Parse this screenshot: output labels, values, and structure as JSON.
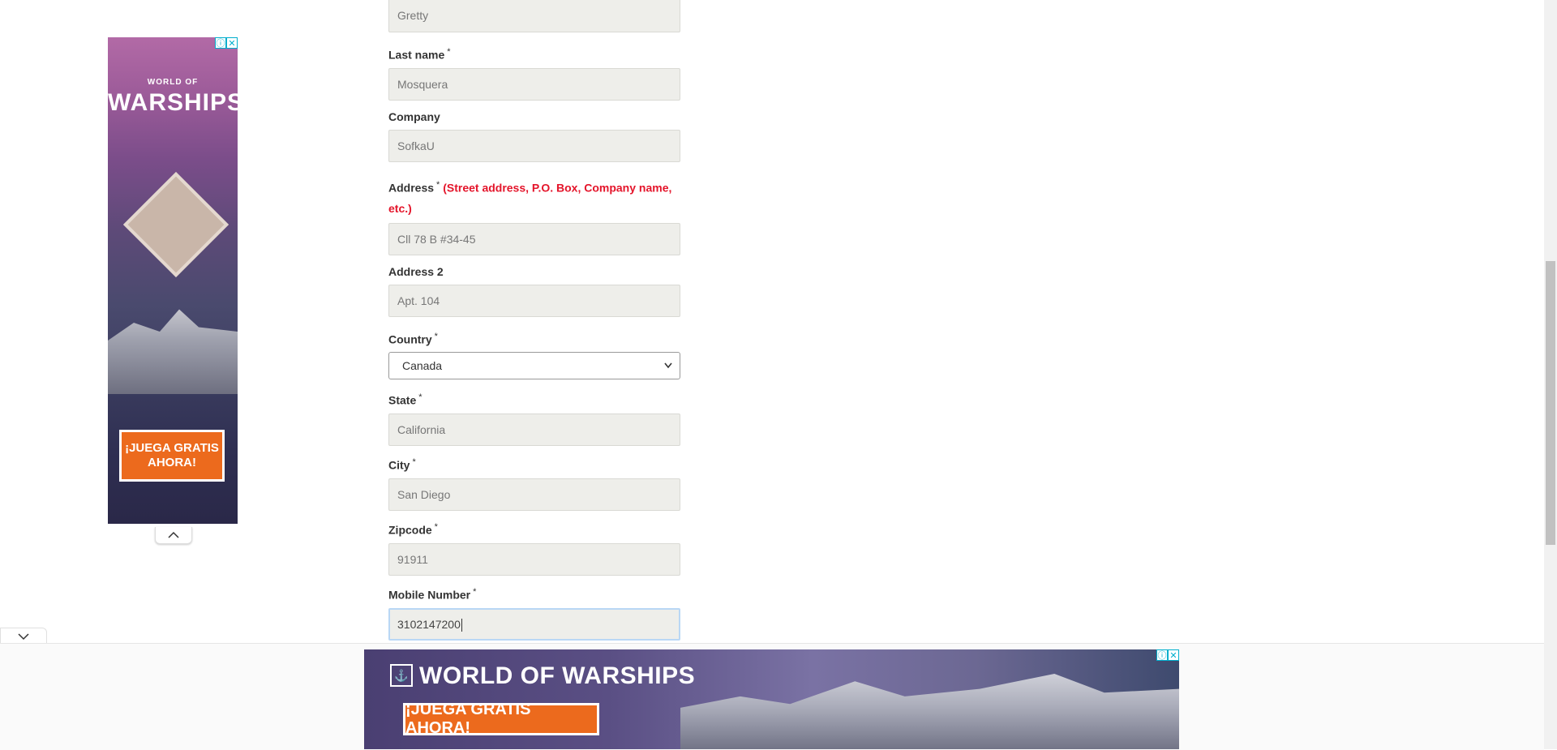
{
  "form": {
    "first_name": {
      "value": "Gretty"
    },
    "last_name": {
      "label": "Last name",
      "required": "*",
      "value": "Mosquera"
    },
    "company": {
      "label": "Company",
      "value": "SofkaU"
    },
    "address": {
      "label": "Address",
      "required": "*",
      "hint": "(Street address, P.O. Box, Company name, etc.)",
      "value": "Cll 78 B #34-45"
    },
    "address2": {
      "label": "Address 2",
      "value": "Apt. 104"
    },
    "country": {
      "label": "Country",
      "required": "*",
      "selected": "Canada"
    },
    "state": {
      "label": "State",
      "required": "*",
      "value": "California"
    },
    "city": {
      "label": "City",
      "required": "*",
      "value": "San Diego"
    },
    "zipcode": {
      "label": "Zipcode",
      "required": "*",
      "value": "91911"
    },
    "mobile": {
      "label": "Mobile Number",
      "required": "*",
      "value": "3102147200"
    }
  },
  "side_ad": {
    "brand_small": "WORLD OF",
    "brand_big": "WARSHIPS",
    "cta": "¡JUEGA GRATIS AHORA!",
    "info_icon": "ⓘ",
    "close_icon": "✕"
  },
  "bottom_ad": {
    "brand": "WORLD OF WARSHIPS",
    "cta": "¡JUEGA GRATIS AHORA!",
    "info_icon": "ⓘ",
    "close_icon": "✕"
  },
  "colors": {
    "required_hint": "#e4142a",
    "input_bg": "#eeeeea",
    "ad_cta": "#ec6a1d"
  }
}
